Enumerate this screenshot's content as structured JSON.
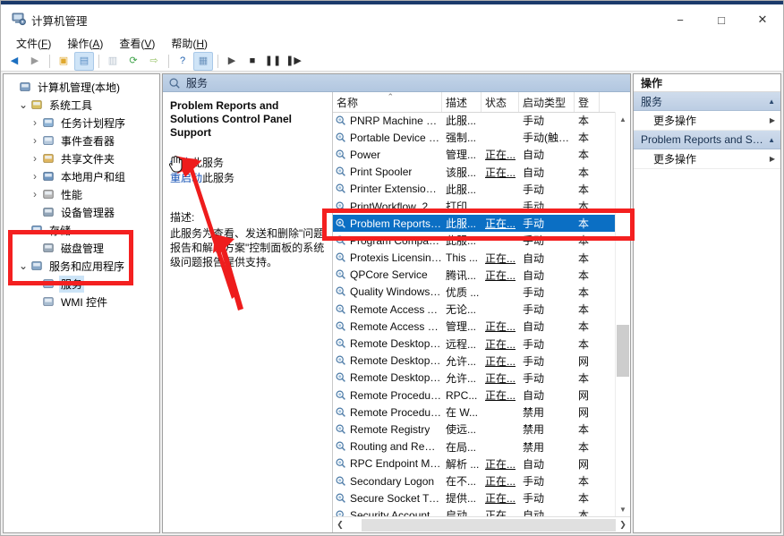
{
  "window": {
    "title": "计算机管理",
    "icon": "computer-management-icon",
    "minimize": "−",
    "maximize": "□",
    "close": "✕"
  },
  "menubar": [
    {
      "label": "文件",
      "accel": "F"
    },
    {
      "label": "操作",
      "accel": "A"
    },
    {
      "label": "查看",
      "accel": "V"
    },
    {
      "label": "帮助",
      "accel": "H"
    }
  ],
  "toolbar": [
    {
      "name": "back-icon",
      "glyph": "◀",
      "color": "#1c6fc0",
      "selected": false
    },
    {
      "name": "forward-icon",
      "glyph": "▶",
      "color": "#9a9a9a",
      "selected": false
    },
    {
      "name": "up-folder-icon",
      "glyph": "▣",
      "color": "#e0a82e",
      "selected": false
    },
    {
      "name": "show-tree-icon",
      "glyph": "▤",
      "color": "#5c8fc4",
      "selected": true
    },
    {
      "name": "properties-icon",
      "glyph": "▥",
      "color": "#b9c4cf",
      "selected": false
    },
    {
      "name": "refresh-icon",
      "glyph": "⟳",
      "color": "#3fa34a",
      "selected": false
    },
    {
      "name": "export-list-icon",
      "glyph": "⇨",
      "color": "#9ac46a",
      "selected": false
    },
    {
      "name": "help-icon",
      "glyph": "?",
      "color": "#1d5fae",
      "selected": false
    },
    {
      "name": "new-window-icon",
      "glyph": "▦",
      "color": "#6d94bd",
      "selected": true
    },
    {
      "name": "start-service-icon",
      "glyph": "▶",
      "color": "#4d4d4d",
      "selected": false
    },
    {
      "name": "stop-service-icon",
      "glyph": "■",
      "color": "#2b2b2b",
      "selected": false
    },
    {
      "name": "pause-service-icon",
      "glyph": "❚❚",
      "color": "#2b2b2b",
      "selected": false
    },
    {
      "name": "restart-service-icon",
      "glyph": "❚▶",
      "color": "#2b2b2b",
      "selected": false
    }
  ],
  "tree": {
    "root": {
      "label": "计算机管理(本地)",
      "icon": "computer-icon",
      "indent": 0,
      "chevron": "",
      "selected": false
    },
    "items": [
      {
        "label": "系统工具",
        "icon": "system-tools-icon",
        "indent": 1,
        "chevron": "open",
        "selected": false
      },
      {
        "label": "任务计划程序",
        "icon": "task-scheduler-icon",
        "indent": 2,
        "chevron": "closed",
        "selected": false
      },
      {
        "label": "事件查看器",
        "icon": "event-viewer-icon",
        "indent": 2,
        "chevron": "closed",
        "selected": false
      },
      {
        "label": "共享文件夹",
        "icon": "shared-folders-icon",
        "indent": 2,
        "chevron": "closed",
        "selected": false
      },
      {
        "label": "本地用户和组",
        "icon": "local-users-groups-icon",
        "indent": 2,
        "chevron": "closed",
        "selected": false
      },
      {
        "label": "性能",
        "icon": "performance-icon",
        "indent": 2,
        "chevron": "closed",
        "selected": false
      },
      {
        "label": "设备管理器",
        "icon": "device-manager-icon",
        "indent": 2,
        "chevron": "",
        "selected": false
      },
      {
        "label": "存储",
        "icon": "storage-icon",
        "indent": 1,
        "chevron": "open",
        "selected": false
      },
      {
        "label": "磁盘管理",
        "icon": "disk-management-icon",
        "indent": 2,
        "chevron": "",
        "selected": false
      },
      {
        "label": "服务和应用程序",
        "icon": "services-apps-icon",
        "indent": 1,
        "chevron": "open",
        "selected": false
      },
      {
        "label": "服务",
        "icon": "services-icon",
        "indent": 2,
        "chevron": "",
        "selected": true
      },
      {
        "label": "WMI 控件",
        "icon": "wmi-control-icon",
        "indent": 2,
        "chevron": "",
        "selected": false
      }
    ]
  },
  "mid_header": {
    "title": "服务",
    "icon": "services-gear-icon"
  },
  "detail": {
    "service_title": "Problem Reports and Solutions Control Panel Support",
    "links": [
      {
        "action": "停止",
        "suffix": "此服务",
        "name": "stop-service-link"
      },
      {
        "action": "重启动",
        "suffix": "此服务",
        "name": "restart-service-link"
      }
    ],
    "description_label": "描述:",
    "description": "此服务为查看、发送和删除\"问题报告和解决方案\"控制面板的系统级问题报告提供支持。"
  },
  "list": {
    "columns": [
      {
        "label": "名称",
        "key": "name",
        "sorted": "asc"
      },
      {
        "label": "描述",
        "key": "desc",
        "sorted": ""
      },
      {
        "label": "状态",
        "key": "state",
        "sorted": ""
      },
      {
        "label": "启动类型",
        "key": "start",
        "sorted": ""
      },
      {
        "label": "登",
        "key": "logon",
        "sorted": ""
      }
    ],
    "rows": [
      {
        "name": "PNRP Machine Name Pu...",
        "desc": "此服...",
        "state": "",
        "start": "手动",
        "logon": "本",
        "selected": false
      },
      {
        "name": "Portable Device Enumera...",
        "desc": "强制...",
        "state": "",
        "start": "手动(触发...",
        "logon": "本",
        "selected": false
      },
      {
        "name": "Power",
        "desc": "管理...",
        "state": "正在...",
        "start": "自动",
        "logon": "本",
        "selected": false
      },
      {
        "name": "Print Spooler",
        "desc": "该服...",
        "state": "正在...",
        "start": "自动",
        "logon": "本",
        "selected": false
      },
      {
        "name": "Printer Extensions and N...",
        "desc": "此服...",
        "state": "",
        "start": "手动",
        "logon": "本",
        "selected": false
      },
      {
        "name": "PrintWorkflow_2c75e02d",
        "desc": "打印...",
        "state": "",
        "start": "手动",
        "logon": "本",
        "selected": false
      },
      {
        "name": "Problem Reports and Sol...",
        "desc": "此服...",
        "state": "正在...",
        "start": "手动",
        "logon": "本",
        "selected": true
      },
      {
        "name": "Program Compatibility As...",
        "desc": "此服...",
        "state": "",
        "start": "手动",
        "logon": "本",
        "selected": false
      },
      {
        "name": "Protexis Licensing V2 x64",
        "desc": "This ...",
        "state": "正在...",
        "start": "自动",
        "logon": "本",
        "selected": false
      },
      {
        "name": "QPCore Service",
        "desc": "腾讯...",
        "state": "正在...",
        "start": "自动",
        "logon": "本",
        "selected": false
      },
      {
        "name": "Quality Windows Audio V...",
        "desc": "优质 ...",
        "state": "",
        "start": "手动",
        "logon": "本",
        "selected": false
      },
      {
        "name": "Remote Access Auto Con...",
        "desc": "无论...",
        "state": "",
        "start": "手动",
        "logon": "本",
        "selected": false
      },
      {
        "name": "Remote Access Connecti...",
        "desc": "管理...",
        "state": "正在...",
        "start": "自动",
        "logon": "本",
        "selected": false
      },
      {
        "name": "Remote Desktop Configu...",
        "desc": "远程...",
        "state": "正在...",
        "start": "手动",
        "logon": "本",
        "selected": false
      },
      {
        "name": "Remote Desktop Services",
        "desc": "允许...",
        "state": "正在...",
        "start": "手动",
        "logon": "网",
        "selected": false
      },
      {
        "name": "Remote Desktop Service...",
        "desc": "允许...",
        "state": "正在...",
        "start": "手动",
        "logon": "本",
        "selected": false
      },
      {
        "name": "Remote Procedure Call (...",
        "desc": "RPC...",
        "state": "正在...",
        "start": "自动",
        "logon": "网",
        "selected": false
      },
      {
        "name": "Remote Procedure Call (...",
        "desc": "在 W...",
        "state": "",
        "start": "禁用",
        "logon": "网",
        "selected": false
      },
      {
        "name": "Remote Registry",
        "desc": "使远...",
        "state": "",
        "start": "禁用",
        "logon": "本",
        "selected": false
      },
      {
        "name": "Routing and Remote Acc...",
        "desc": "在局...",
        "state": "",
        "start": "禁用",
        "logon": "本",
        "selected": false
      },
      {
        "name": "RPC Endpoint Mapper",
        "desc": "解析 ...",
        "state": "正在...",
        "start": "自动",
        "logon": "网",
        "selected": false
      },
      {
        "name": "Secondary Logon",
        "desc": "在不...",
        "state": "正在...",
        "start": "手动",
        "logon": "本",
        "selected": false
      },
      {
        "name": "Secure Socket Tunneling ...",
        "desc": "提供...",
        "state": "正在...",
        "start": "手动",
        "logon": "本",
        "selected": false
      },
      {
        "name": "Security Accounts Manag...",
        "desc": "启动...",
        "state": "正在...",
        "start": "自动",
        "logon": "本",
        "selected": false
      }
    ]
  },
  "actions": {
    "title": "操作",
    "sections": [
      {
        "label": "服务",
        "name": "actions-section-services",
        "items": [
          {
            "label": "更多操作",
            "name": "more-actions-services"
          }
        ]
      },
      {
        "label": "Problem Reports and Sol...",
        "name": "actions-section-selected-service",
        "items": [
          {
            "label": "更多操作",
            "name": "more-actions-selected-service"
          }
        ]
      }
    ],
    "collapse_caret": "▲",
    "submenu_caret": "▶"
  },
  "annotations": {
    "highlight_color": "#f42020",
    "boxes": [
      {
        "name": "annotation-box-tree-services",
        "target": "服务和应用程序 / 服务 / WMI 控件"
      },
      {
        "name": "annotation-box-selected-row",
        "target": "Problem Reports and Sol..."
      }
    ],
    "arrows": [
      {
        "name": "annotation-arrow-to-restart-link",
        "target": "重启动此服务"
      },
      {
        "name": "annotation-arrow-to-selected-row",
        "target": "Problem Reports and Sol..."
      }
    ]
  }
}
